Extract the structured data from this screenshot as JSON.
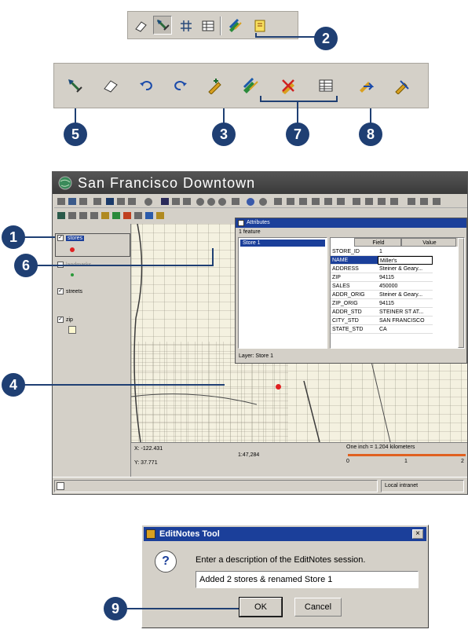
{
  "callouts": {
    "c1": "1",
    "c2": "2",
    "c3": "3",
    "c4": "4",
    "c5": "5",
    "c6": "6",
    "c7": "7",
    "c8": "8",
    "c9": "9"
  },
  "top_toolbar": {
    "tools": [
      "eraser-icon",
      "select-note-icon",
      "grid-icon",
      "table-icon",
      "edit-notes-icon",
      "notes-icon"
    ]
  },
  "edit_toolbar": {
    "tools": [
      "select-note-icon",
      "eraser-icon",
      "undo-icon",
      "redo-icon",
      "add-note-icon",
      "edit-notes-icon",
      "delete-notes-icon",
      "table-icon",
      "pencil-arrow-icon",
      "pencil-icon"
    ]
  },
  "app_window": {
    "title": "San Francisco Downtown",
    "toc": {
      "layers": [
        {
          "name": "stores",
          "checked": true
        },
        {
          "name": "landmarks",
          "checked": false
        },
        {
          "name": "streets",
          "checked": true
        },
        {
          "name": "zip",
          "checked": true
        }
      ]
    },
    "status": {
      "x_coord": "X: -122.431",
      "y_coord": "Y: 37.771",
      "scale": "1:47,284",
      "scale_label": "One inch = 1.204 kilometers",
      "scale_ticks": [
        "0",
        "1",
        "2"
      ]
    },
    "statusbar": {
      "zone": "Local intranet"
    }
  },
  "attributes_dialog": {
    "title": "Attributes",
    "feature_count": "1 feature",
    "selected_item": "Store 1",
    "col_field": "Field",
    "col_value": "Value",
    "rows": [
      {
        "field": "STORE_ID",
        "value": "1"
      },
      {
        "field": "NAME",
        "value": "Miller's"
      },
      {
        "field": "ADDRESS",
        "value": "Steiner & Geary..."
      },
      {
        "field": "ZIP",
        "value": "94115"
      },
      {
        "field": "SALES",
        "value": "450000"
      },
      {
        "field": "ADDR_ORIG",
        "value": "Steiner & Geary..."
      },
      {
        "field": "ZIP_ORIG",
        "value": "94115"
      },
      {
        "field": "ADDR_STD",
        "value": "STEINER ST AT..."
      },
      {
        "field": "CITY_STD",
        "value": "SAN FRANCISCO"
      },
      {
        "field": "STATE_STD",
        "value": "CA"
      }
    ],
    "layer_label": "Layer: Store 1"
  },
  "editnotes_dialog": {
    "title": "EditNotes Tool",
    "close_label": "×",
    "prompt": "Enter a description of the EditNotes session.",
    "input_value": "Added 2 stores & renamed  Store 1",
    "ok_label": "OK",
    "cancel_label": "Cancel"
  },
  "colors": {
    "callout": "#1f3f73",
    "point_red": "#e02020",
    "point_green": "#2a9a3a",
    "selection": "#1b3f9a",
    "scale_bar": "#e06020"
  }
}
